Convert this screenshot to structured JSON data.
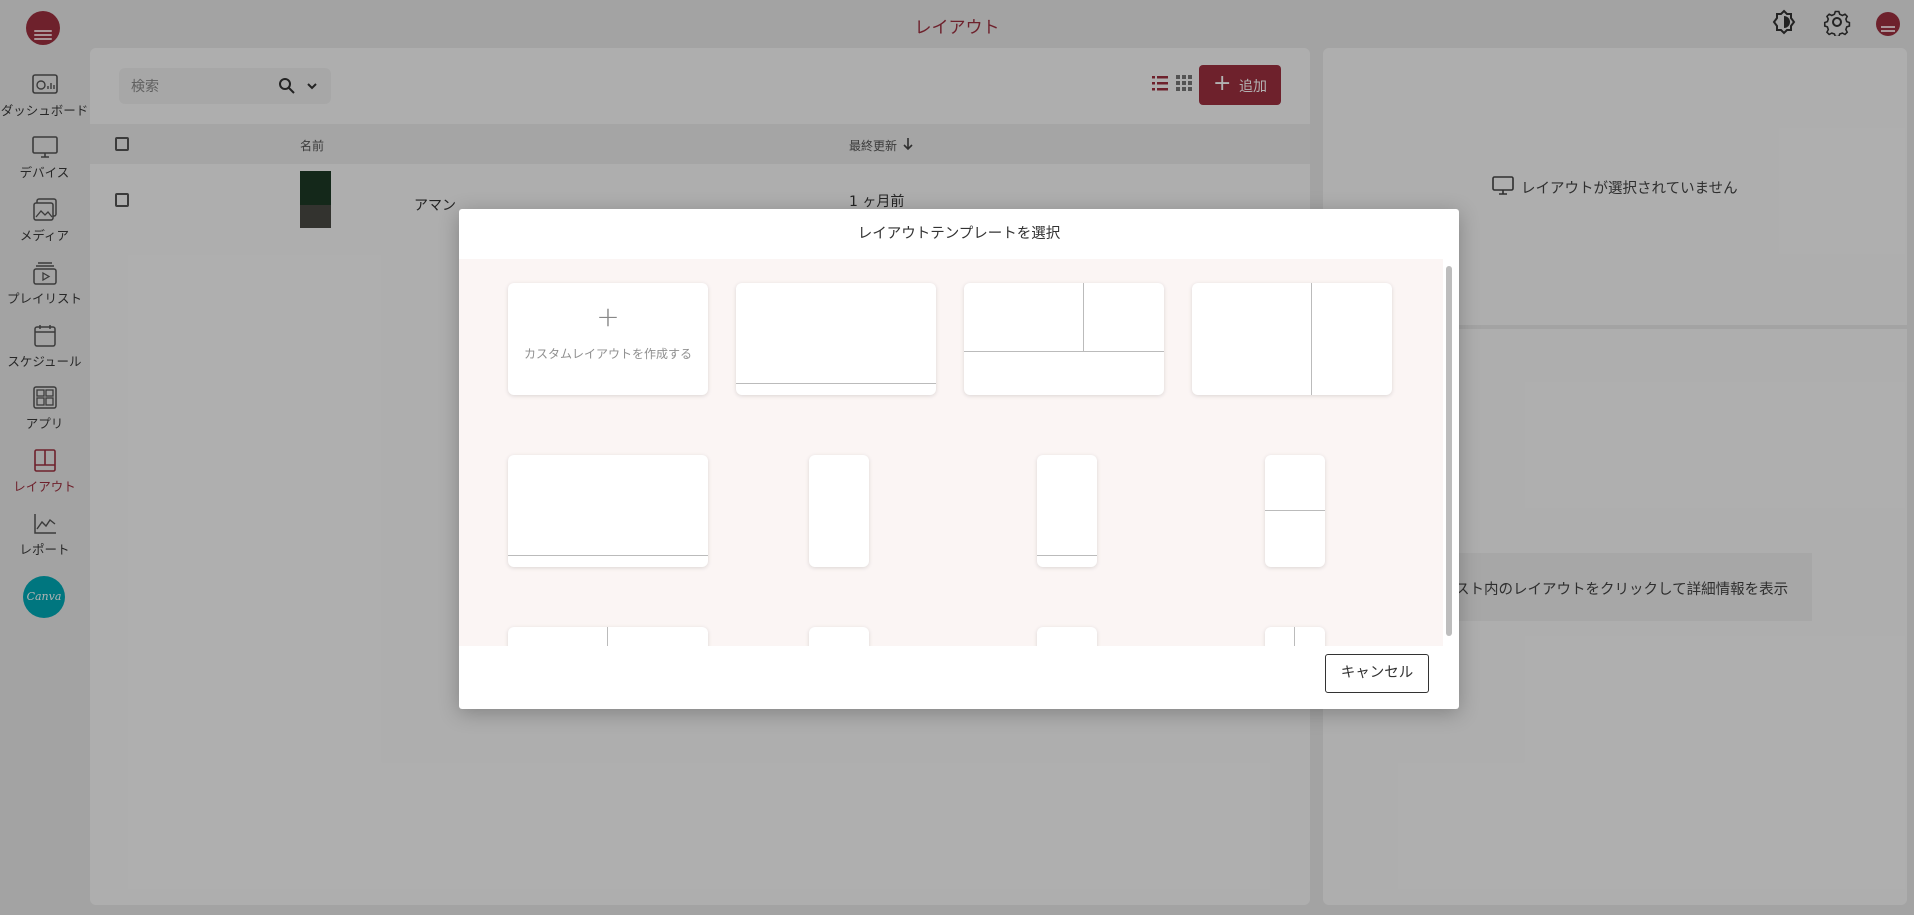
{
  "app": {
    "title": "レイアウト",
    "brand_color": "#9e3040"
  },
  "header": {
    "icons": [
      "theme-toggle-icon",
      "settings-gear-icon",
      "user-avatar-icon"
    ]
  },
  "sidebar": {
    "items": [
      {
        "label": "ダッシュボード",
        "icon": "dashboard-icon"
      },
      {
        "label": "デバイス",
        "icon": "monitor-icon"
      },
      {
        "label": "メディア",
        "icon": "media-icon"
      },
      {
        "label": "プレイリスト",
        "icon": "playlist-icon"
      },
      {
        "label": "スケジュール",
        "icon": "calendar-icon"
      },
      {
        "label": "アプリ",
        "icon": "apps-icon"
      },
      {
        "label": "レイアウト",
        "icon": "layout-icon",
        "active": true
      },
      {
        "label": "レポート",
        "icon": "chart-icon"
      }
    ],
    "canva_label": "Canva"
  },
  "toolbar": {
    "search_placeholder": "検索",
    "add_label": "追加"
  },
  "table": {
    "columns": [
      "名前",
      "最終更新"
    ],
    "rows": [
      {
        "name": "アマン",
        "updated": "1 ヶ月前"
      }
    ]
  },
  "details": {
    "no_selection": "レイアウトが選択されていません",
    "hint": "スト内のレイアウトをクリックして詳細情報を表示"
  },
  "dialog": {
    "title": "レイアウトテンプレートを選択",
    "custom_label": "カスタムレイアウトを作成する",
    "cancel_label": "キャンセル"
  }
}
